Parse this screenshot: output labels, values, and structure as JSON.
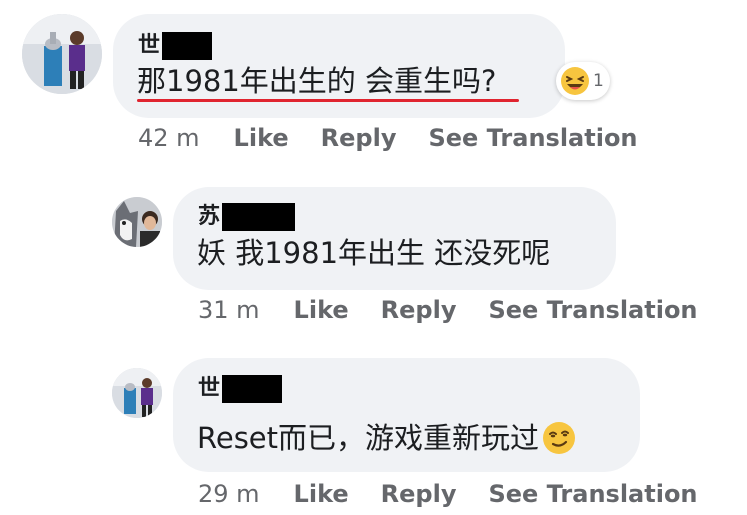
{
  "comments": [
    {
      "author": "世",
      "text": "那1981年出生的 会重生吗?",
      "reaction_count": "1",
      "time": "42 m",
      "actions": {
        "like": "Like",
        "reply": "Reply",
        "translate": "See Translation"
      }
    },
    {
      "author": "苏",
      "text": "妖  我1981年出生  还没死呢",
      "time": "31 m",
      "actions": {
        "like": "Like",
        "reply": "Reply",
        "translate": "See Translation"
      }
    },
    {
      "author": "世",
      "text": "Reset而已，游戏重新玩过",
      "time": "29 m",
      "actions": {
        "like": "Like",
        "reply": "Reply",
        "translate": "See Translation"
      }
    }
  ],
  "colors": {
    "bubble": "#f0f2f5",
    "underline": "#e0242f",
    "action_text": "#65676b",
    "redaction": "#000000"
  },
  "icons": {
    "reaction": "laughing-face-emoji",
    "inline_emoji": "smirk-face-emoji"
  }
}
